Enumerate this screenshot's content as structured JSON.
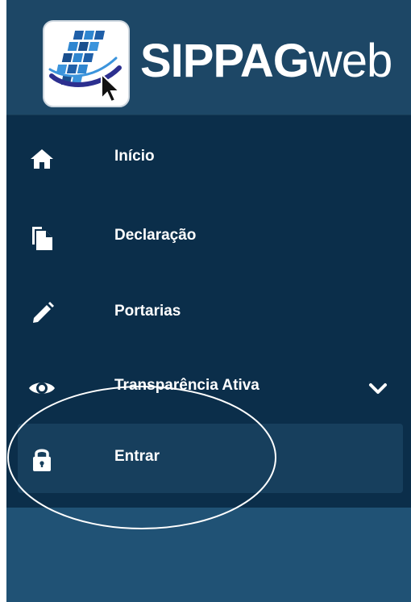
{
  "brand": {
    "name_bold": "SIPPAG",
    "name_light": "web",
    "logo_icon": "sippag-logo-icon"
  },
  "nav": {
    "items": [
      {
        "label": "Início",
        "icon": "home-icon"
      },
      {
        "label": "Declaração",
        "icon": "documents-icon"
      },
      {
        "label": "Portarias",
        "icon": "pencil-icon"
      },
      {
        "label": "Transparência Ativa",
        "icon": "eye-icon",
        "chevron": "chevron-down-icon"
      },
      {
        "label": "Entrar",
        "icon": "lock-icon",
        "active": true
      }
    ]
  },
  "colors": {
    "header_bg": "#1d4766",
    "nav_bg": "#0b2e4a",
    "active_bg": "#173f5d",
    "bottom_bg": "#205275",
    "text": "#ffffff"
  }
}
